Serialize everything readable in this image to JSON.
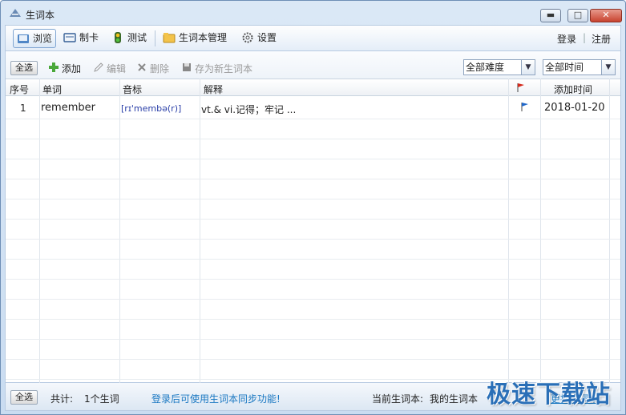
{
  "window": {
    "title": "生词本",
    "minimize_symbol": "▬",
    "maximize_symbol": "□",
    "close_symbol": "✕"
  },
  "nav": {
    "items": [
      {
        "label": "浏览",
        "icon": "book-icon"
      },
      {
        "label": "制卡",
        "icon": "card-icon"
      },
      {
        "label": "测试",
        "icon": "traffic-light-icon"
      },
      {
        "label": "生词本管理",
        "icon": "folder-icon"
      },
      {
        "label": "设置",
        "icon": "gear-icon"
      }
    ],
    "login": "登录",
    "divider": "|",
    "register": "注册"
  },
  "toolbar": {
    "select_all": "全选",
    "add": "添加",
    "edit": "编辑",
    "delete": "删除",
    "save_as": "存为新生词本",
    "difficulty_value": "全部难度",
    "time_value": "全部时间"
  },
  "table": {
    "headers": [
      "序号",
      "单词",
      "音标",
      "解释",
      "",
      "添加时间"
    ],
    "rows": [
      {
        "index": "1",
        "word": "remember",
        "phonetic": "[rɪ'membə(r)]",
        "definition": "vt.& vi.记得；牢记 ...",
        "flag": "flag-icon",
        "date": "2018-01-20"
      }
    ]
  },
  "status": {
    "select_all": "全选",
    "total_label": "共计:",
    "total_value": "1个生词",
    "sync_hint": "登录后可使用生词本同步功能!",
    "current_label": "当前生词本:",
    "current_value": "我的生词本",
    "change_link": "更换生词本"
  },
  "watermark": "极速下载站",
  "colors": {
    "accent": "#2a6fb7",
    "link": "#1a78c2",
    "phonetic": "#2a3fa8",
    "flag_red": "#d42a1c",
    "flag_blue": "#2067c9"
  }
}
